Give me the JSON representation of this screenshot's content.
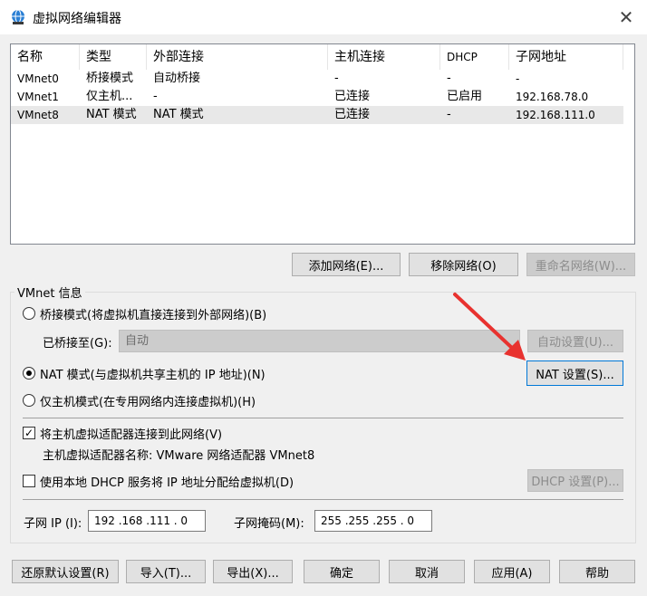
{
  "window": {
    "title": "虚拟网络编辑器",
    "close_glyph": "✕"
  },
  "list": {
    "columns": [
      "名称",
      "类型",
      "外部连接",
      "主机连接",
      "DHCP",
      "子网地址"
    ],
    "rows": [
      [
        "VMnet0",
        "桥接模式",
        "自动桥接",
        "-",
        "-",
        "-"
      ],
      [
        "VMnet1",
        "仅主机...",
        "-",
        "已连接",
        "已启用",
        "192.168.78.0"
      ],
      [
        "VMnet8",
        "NAT 模式",
        "NAT 模式",
        "已连接",
        "-",
        "192.168.111.0"
      ]
    ],
    "selected_row": 2
  },
  "list_buttons": {
    "add": "添加网络(E)...",
    "remove": "移除网络(O)",
    "rename": "重命名网络(W)..."
  },
  "vmnet_info": {
    "group_title": "VMnet 信息",
    "bridge_radio": "桥接模式(将虚拟机直接连接到外部网络)(B)",
    "bridged_to_label": "已桥接至(G):",
    "bridged_to_value": "自动",
    "auto_settings": "自动设置(U)...",
    "nat_radio": "NAT 模式(与虚拟机共享主机的 IP 地址)(N)",
    "nat_settings": "NAT 设置(S)...",
    "hostonly_radio": "仅主机模式(在专用网络内连接虚拟机)(H)",
    "connect_adapter_check": "将主机虚拟适配器连接到此网络(V)",
    "adapter_name": "主机虚拟适配器名称: VMware 网络适配器 VMnet8",
    "dhcp_check": "使用本地 DHCP 服务将 IP 地址分配给虚拟机(D)",
    "dhcp_settings": "DHCP 设置(P)...",
    "subnet_ip_label": "子网 IP (I):",
    "subnet_ip_value": "192 .168 .111 .  0",
    "subnet_mask_label": "子网掩码(M):",
    "subnet_mask_value": "255 .255 .255 .  0"
  },
  "state": {
    "selected_mode": "nat",
    "connect_adapter_checked": true,
    "dhcp_checked": false
  },
  "bottom_buttons": {
    "restore": "还原默认设置(R)",
    "import": "导入(T)...",
    "export": "导出(X)...",
    "ok": "确定",
    "cancel": "取消",
    "apply": "应用(A)",
    "help": "帮助"
  },
  "colors": {
    "annotation_arrow": "#e8322f",
    "focus_border": "#0078d7",
    "selected_row": "#e8e8e8"
  }
}
